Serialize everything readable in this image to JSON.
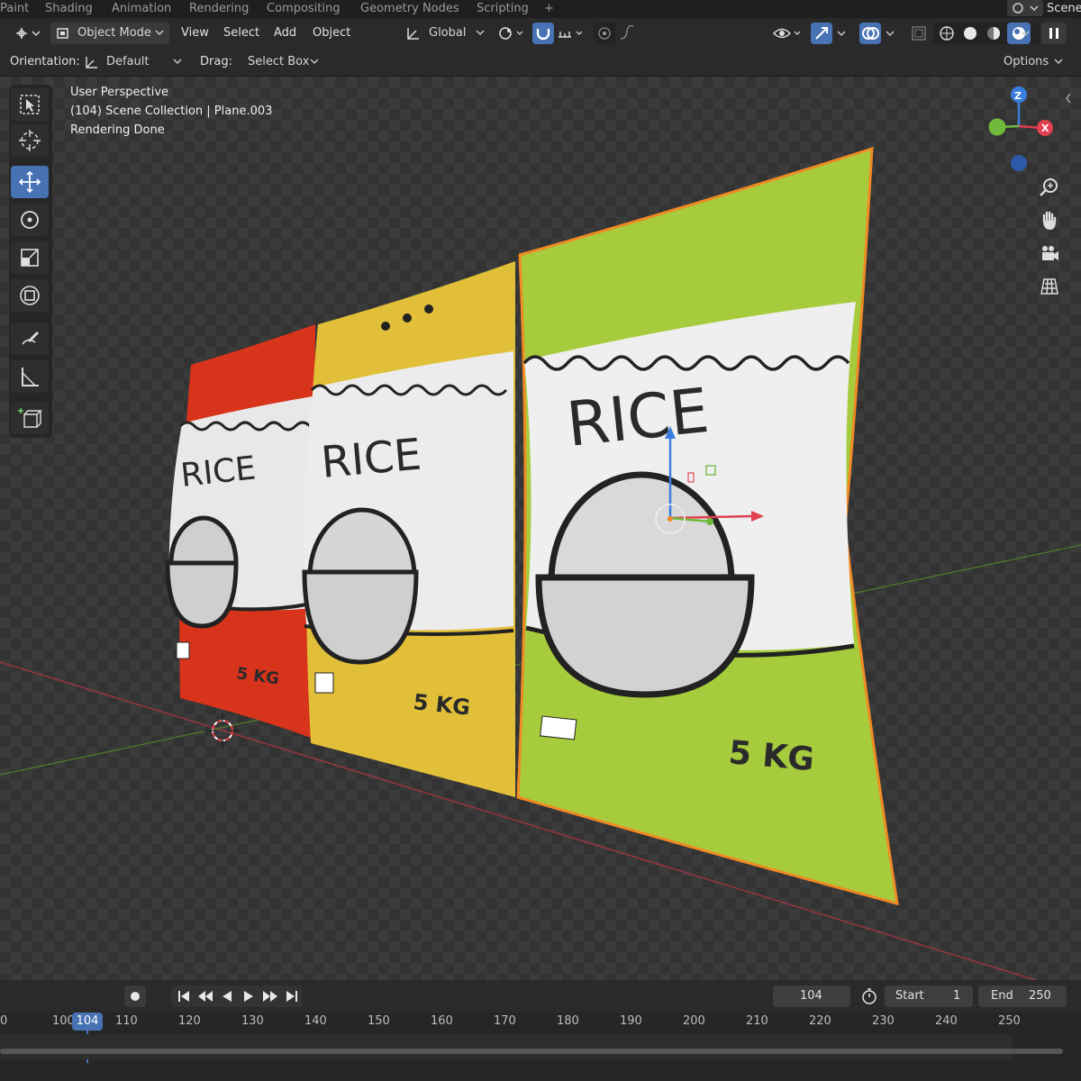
{
  "workspace_tabs": [
    "Paint",
    "Shading",
    "Animation",
    "Rendering",
    "Compositing",
    "Geometry Nodes",
    "Scripting",
    "+"
  ],
  "scene_label": "Scene",
  "header": {
    "mode": "Object Mode",
    "menus": [
      "View",
      "Select",
      "Add",
      "Object"
    ],
    "transform_orientation": "Global"
  },
  "tool_settings": {
    "orientation_label": "Orientation:",
    "orientation_value": "Default",
    "drag_label": "Drag:",
    "drag_value": "Select Box",
    "options_label": "Options"
  },
  "viewport": {
    "overlay_lines": [
      "User Perspective",
      "(104) Scene Collection | Plane.003",
      "Rendering Done"
    ],
    "gizmo_axes": [
      "Z",
      "X"
    ],
    "nav_icons": [
      "zoom-icon",
      "hand-icon",
      "camera-icon",
      "grid-icon"
    ],
    "packages": [
      {
        "color": "red",
        "title": "RICE",
        "weight": "5 KG",
        "hex": "#d8331b"
      },
      {
        "color": "yellow",
        "title": "RICE",
        "weight": "5 KG",
        "hex": "#e2bf38"
      },
      {
        "color": "green",
        "title": "RICE",
        "weight": "5 KG",
        "hex": "#a6cc3d"
      }
    ]
  },
  "timeline": {
    "current_frame": "104",
    "start_label": "Start",
    "start_value": "1",
    "end_label": "End",
    "end_value": "250",
    "ruler_ticks": [
      "0",
      "100",
      "104",
      "110",
      "120",
      "130",
      "140",
      "150",
      "160",
      "170",
      "180",
      "190",
      "200",
      "210",
      "220",
      "230",
      "240",
      "250"
    ]
  },
  "colors": {
    "accent": "#4772b3",
    "selection_outline": "#f08a24",
    "axis_x": "#e04050",
    "axis_y": "#6fba3a",
    "axis_z": "#3a7ee0"
  }
}
